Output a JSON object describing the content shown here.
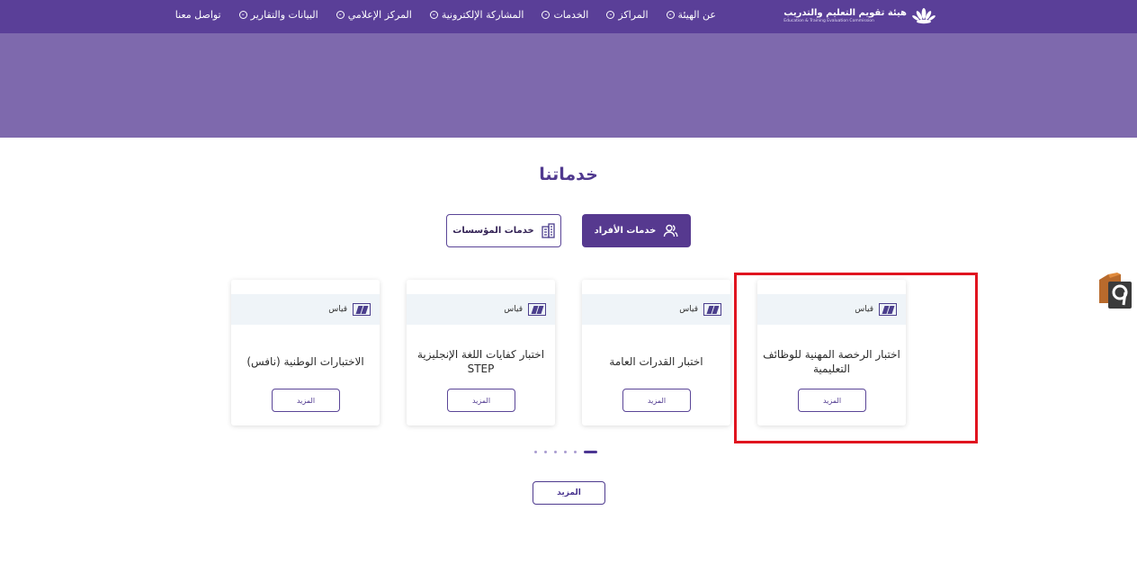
{
  "header": {
    "logo_ar": "هيئة تقويم التعليم والتدريب",
    "logo_en": "Education & Training Evaluation Commission",
    "nav": [
      {
        "label": "عن الهيئة",
        "icon": "chevron-down-icon"
      },
      {
        "label": "المراكز",
        "icon": "chevron-down-icon"
      },
      {
        "label": "الخدمات",
        "icon": "chevron-down-icon"
      },
      {
        "label": "المشاركة الإلكترونية",
        "icon": "chevron-down-icon"
      },
      {
        "label": "المركز الإعلامي",
        "icon": "chevron-down-icon"
      },
      {
        "label": "البيانات والتقارير",
        "icon": "chevron-down-icon"
      },
      {
        "label": "تواصل معنا",
        "icon": ""
      }
    ]
  },
  "services": {
    "title": "خدماتنا",
    "tabs": [
      {
        "label": "خدمات الأفراد",
        "icon": "users-icon",
        "active": true
      },
      {
        "label": "خدمات المؤسسات",
        "icon": "building-icon",
        "active": false
      }
    ],
    "cards": [
      {
        "provider": "قياس",
        "title": "اختبار الرخصة المهنية للوظائف التعليمية",
        "button": "المزيد"
      },
      {
        "provider": "قياس",
        "title": "اختبار القدرات العامة",
        "button": "المزيد"
      },
      {
        "provider": "قياس",
        "title": "اختبار كفايات اللغة الإنجليزية STEP",
        "button": "المزيد"
      },
      {
        "provider": "قياس",
        "title": "الاختبارات الوطنية (نافس)",
        "button": "المزيد"
      }
    ],
    "pagination": {
      "total": 6,
      "active_index": 0
    },
    "more_button": "المزيد"
  },
  "colors": {
    "primary": "#5a3f98",
    "hero": "#7e69ad",
    "highlight": "#e0141f"
  }
}
